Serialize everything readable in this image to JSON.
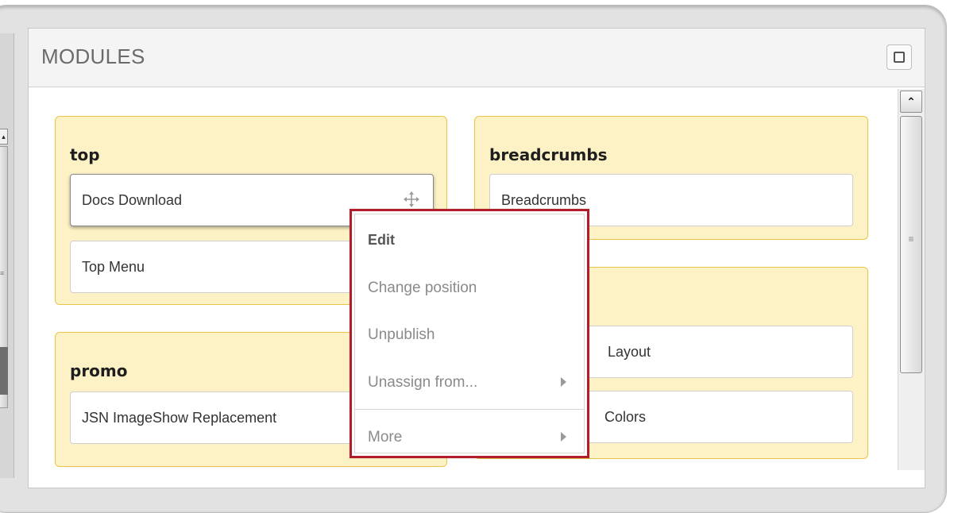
{
  "panel": {
    "title": "MODULES"
  },
  "positions": [
    {
      "title": "top",
      "modules": [
        "Docs Download",
        "Top Menu"
      ]
    },
    {
      "title": "breadcrumbs",
      "modules": [
        "Breadcrumbs"
      ]
    },
    {
      "title": "promo",
      "modules": [
        "JSN ImageShow Replacement"
      ]
    },
    {
      "title": "",
      "modules": [
        "Layout",
        "Colors"
      ]
    }
  ],
  "context_menu": {
    "items": [
      "Edit",
      "Change position",
      "Unpublish",
      "Unassign from...",
      "More"
    ]
  },
  "colors": {
    "card_background": "#fdf2c6",
    "card_border": "#e8c44a",
    "menu_border": "#b11d2b"
  }
}
